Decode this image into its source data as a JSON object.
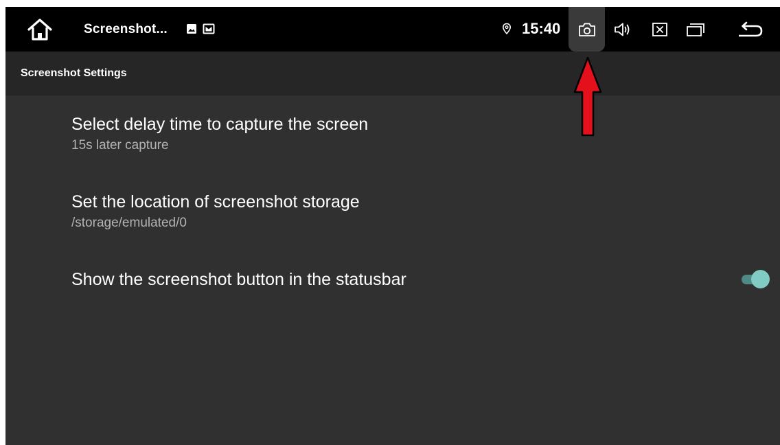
{
  "statusbar": {
    "app_title": "Screenshot...",
    "time": "15:40",
    "icons": {
      "home": "home-icon",
      "notification_1": "image-notification-icon",
      "notification_2": "gallery-notification-icon",
      "location": "location-pin-icon",
      "screenshot": "camera-icon",
      "volume": "volume-icon",
      "close": "close-box-icon",
      "recents": "recents-icon",
      "back": "back-arrow-icon"
    }
  },
  "toolbar": {
    "title": "Screenshot Settings"
  },
  "settings": [
    {
      "title": "Select delay time to capture the screen",
      "summary": "15s later capture"
    },
    {
      "title": "Set the location of screenshot storage",
      "summary": "/storage/emulated/0"
    },
    {
      "title": "Show the screenshot button in the statusbar",
      "toggle_on": true
    }
  ],
  "colors": {
    "statusbar_bg": "#000000",
    "toolbar_bg": "#262626",
    "content_bg": "#303030",
    "toggle_thumb": "#80cbc4",
    "toggle_track": "#4f8a84",
    "annotation_arrow": "#e4101b"
  },
  "annotation": {
    "icon": "red-arrow-icon"
  }
}
